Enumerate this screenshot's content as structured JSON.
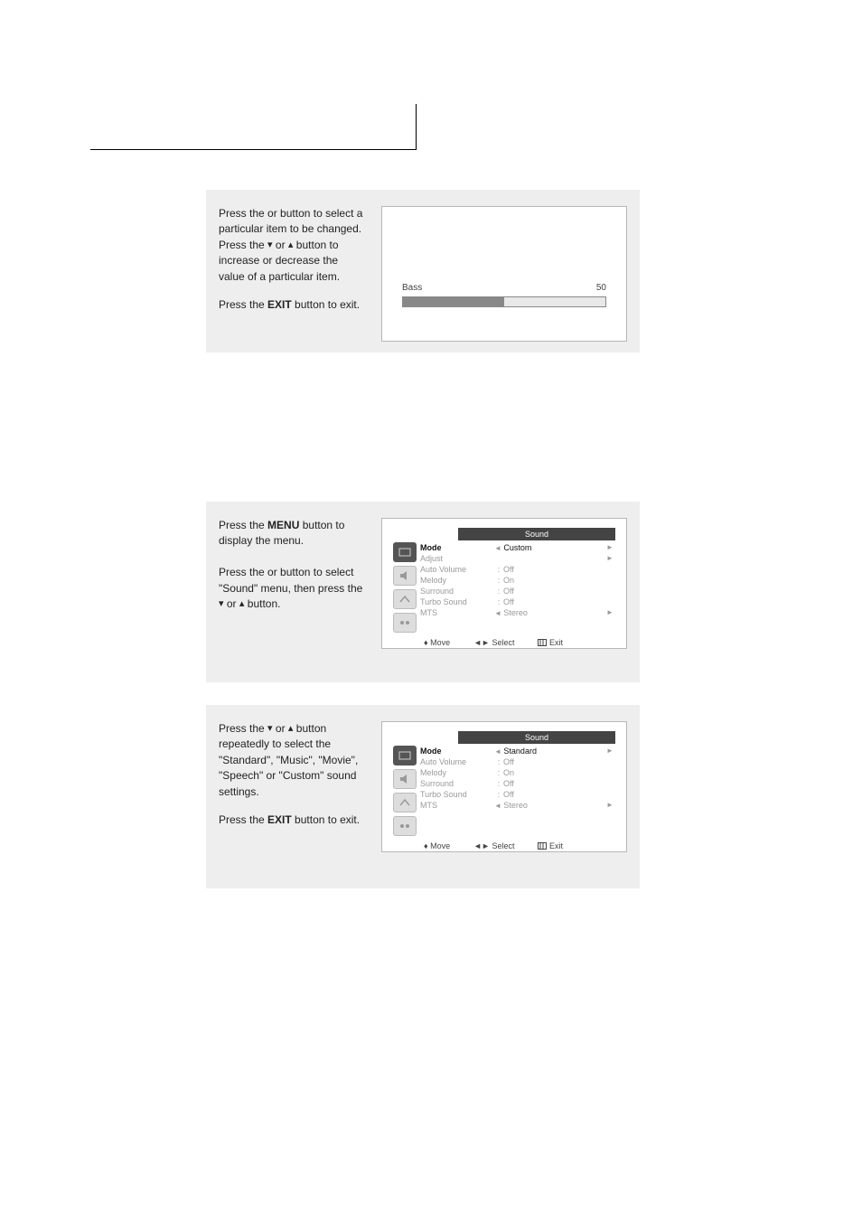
{
  "row1": {
    "text_parts": {
      "p1a": "Press the ",
      "p1b": " or ",
      "p1c": " button to select a particular item to be changed.",
      "p2a": "Press the ",
      "p2b": " or ",
      "p2c": " button to increase or decrease the value of a particular item.",
      "exit_a": "Press the ",
      "exit_bold": "EXIT",
      "exit_b": " button to exit."
    },
    "bass": {
      "label": "Bass",
      "value": "50"
    }
  },
  "row2": {
    "text_parts": {
      "p1a": "Press the ",
      "p1bold": "MENU",
      "p1b": " button to display the menu.",
      "p2a": "Press the ",
      "p2b": " or ",
      "p2c": " button to select  \"Sound\" menu, then press the ",
      "p2d": " or ",
      "p2e": " button."
    },
    "osd": {
      "title": "Sound",
      "items": [
        {
          "label": "Mode",
          "sep": "",
          "val": "Custom",
          "hl": true,
          "arrows": true
        },
        {
          "label": "Adjust",
          "sep": "",
          "val": "",
          "hl": false,
          "arrows_right": true
        },
        {
          "label": "Auto Volume",
          "sep": ":",
          "val": "Off",
          "hl": false
        },
        {
          "label": "Melody",
          "sep": ":",
          "val": "On",
          "hl": false
        },
        {
          "label": "Surround",
          "sep": ":",
          "val": "Off",
          "hl": false
        },
        {
          "label": "Turbo Sound",
          "sep": ":",
          "val": "Off",
          "hl": false
        },
        {
          "label": "MTS",
          "sep": "",
          "val": "Stereo",
          "hl": false,
          "arrows": true
        }
      ],
      "footer": {
        "move": "Move",
        "select": "Select",
        "exit": "Exit"
      }
    }
  },
  "row3": {
    "text_parts": {
      "p1a": "Press the ",
      "p1b": " or ",
      "p1c": " button repeatedly to select the \"Standard\", \"Music\", \"Movie\", \"Speech\" or \"Custom\" sound settings.",
      "exit_a": "Press the ",
      "exit_bold": "EXIT",
      "exit_b": " button to exit."
    },
    "osd": {
      "title": "Sound",
      "items": [
        {
          "label": "Mode",
          "sep": "",
          "val": "Standard",
          "hl": true,
          "arrows": true
        },
        {
          "label": "Auto Volume",
          "sep": ":",
          "val": "Off",
          "hl": false
        },
        {
          "label": "Melody",
          "sep": ":",
          "val": "On",
          "hl": false
        },
        {
          "label": "Surround",
          "sep": ":",
          "val": "Off",
          "hl": false
        },
        {
          "label": "Turbo Sound",
          "sep": ":",
          "val": "Off",
          "hl": false
        },
        {
          "label": "MTS",
          "sep": "",
          "val": "Stereo",
          "hl": false,
          "arrows": true
        }
      ],
      "footer": {
        "move": "Move",
        "select": "Select",
        "exit": "Exit"
      }
    }
  }
}
